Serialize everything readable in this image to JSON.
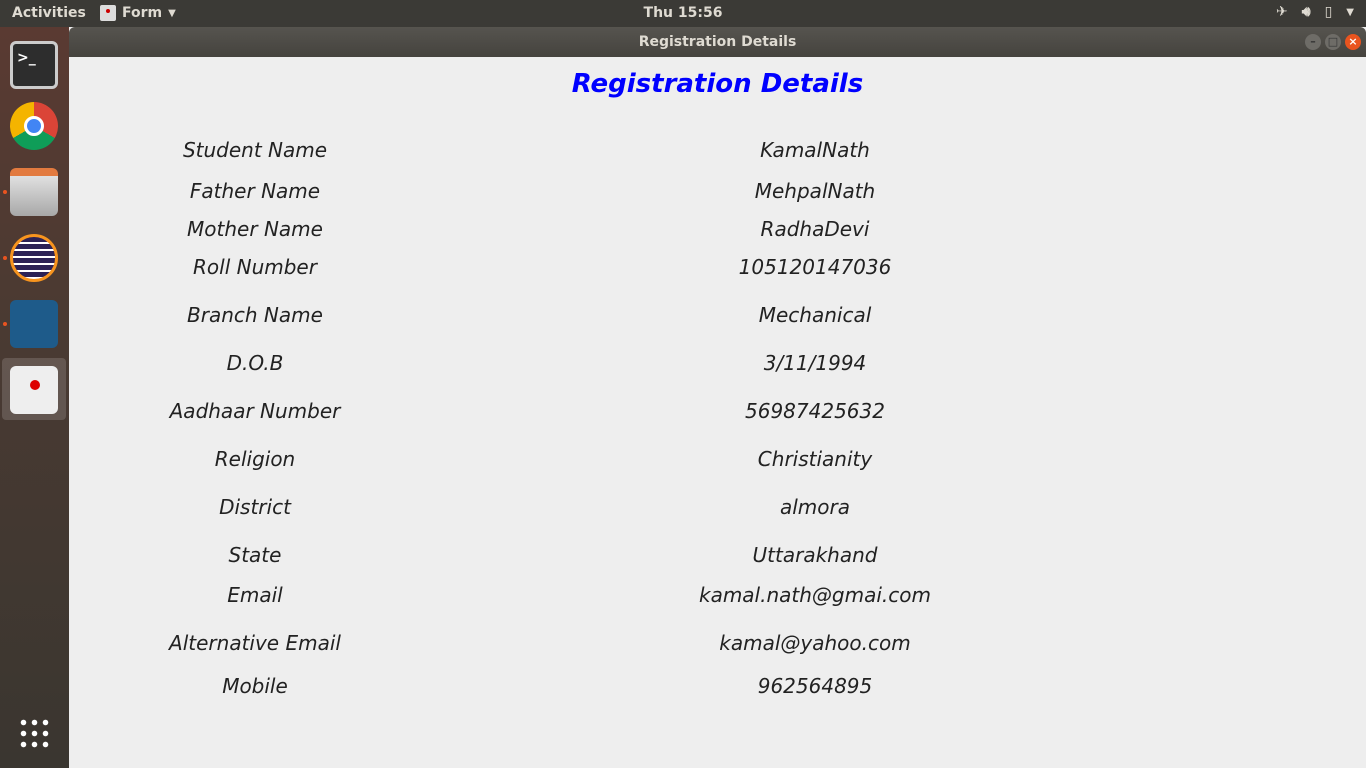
{
  "topbar": {
    "activities": "Activities",
    "app_menu": "Form",
    "clock": "Thu 15:56",
    "tray_icons": [
      "airplane-icon",
      "volume-icon",
      "battery-icon",
      "dropdown-icon"
    ]
  },
  "dock": {
    "apps": [
      "terminal",
      "chrome",
      "files",
      "eclipse",
      "mysql-workbench",
      "java-form"
    ],
    "show_apps": "apps-grid-icon"
  },
  "window": {
    "title": "Registration Details"
  },
  "form": {
    "title": "Registration Details",
    "rows": [
      {
        "label": "Student Name",
        "value": "KamalNath"
      },
      {
        "label": "Father Name",
        "value": "MehpalNath"
      },
      {
        "label": "Mother Name",
        "value": "RadhaDevi"
      },
      {
        "label": "Roll Number",
        "value": "105120147036"
      },
      {
        "label": "Branch Name",
        "value": "Mechanical"
      },
      {
        "label": "D.O.B",
        "value": "3/11/1994"
      },
      {
        "label": "Aadhaar Number",
        "value": "56987425632"
      },
      {
        "label": "Religion",
        "value": "Christianity"
      },
      {
        "label": "District",
        "value": "almora"
      },
      {
        "label": "State",
        "value": "Uttarakhand"
      },
      {
        "label": "Email",
        "value": "kamal.nath@gmai.com"
      },
      {
        "label": "Alternative Email",
        "value": "kamal@yahoo.com"
      },
      {
        "label": "Mobile",
        "value": "962564895"
      }
    ]
  }
}
